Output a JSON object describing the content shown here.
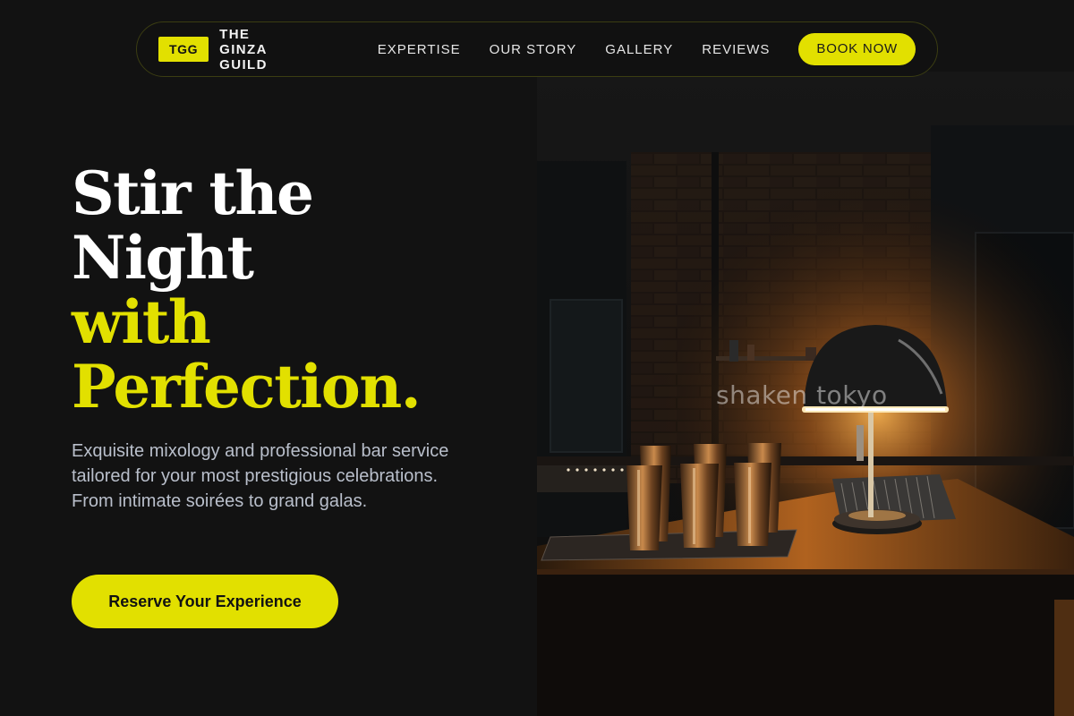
{
  "nav": {
    "badge": "TGG",
    "brand_name": "THE GINZA GUILD",
    "links": [
      {
        "label": "EXPERTISE"
      },
      {
        "label": "OUR STORY"
      },
      {
        "label": "GALLERY"
      },
      {
        "label": "REVIEWS"
      }
    ],
    "book_label": "BOOK NOW"
  },
  "hero": {
    "headline_lines": [
      "Stir the",
      "Night",
      "with",
      "Perfection."
    ],
    "description": "Exquisite mixology and professional bar service tailored for your most prestigious celebrations. From intimate soirées to grand galas.",
    "cta_label": "Reserve Your Experience",
    "image_watermark": "shaken tokyo"
  },
  "colors": {
    "accent": "#e2e000",
    "background": "#121212",
    "body_text": "#b9bfcb"
  }
}
